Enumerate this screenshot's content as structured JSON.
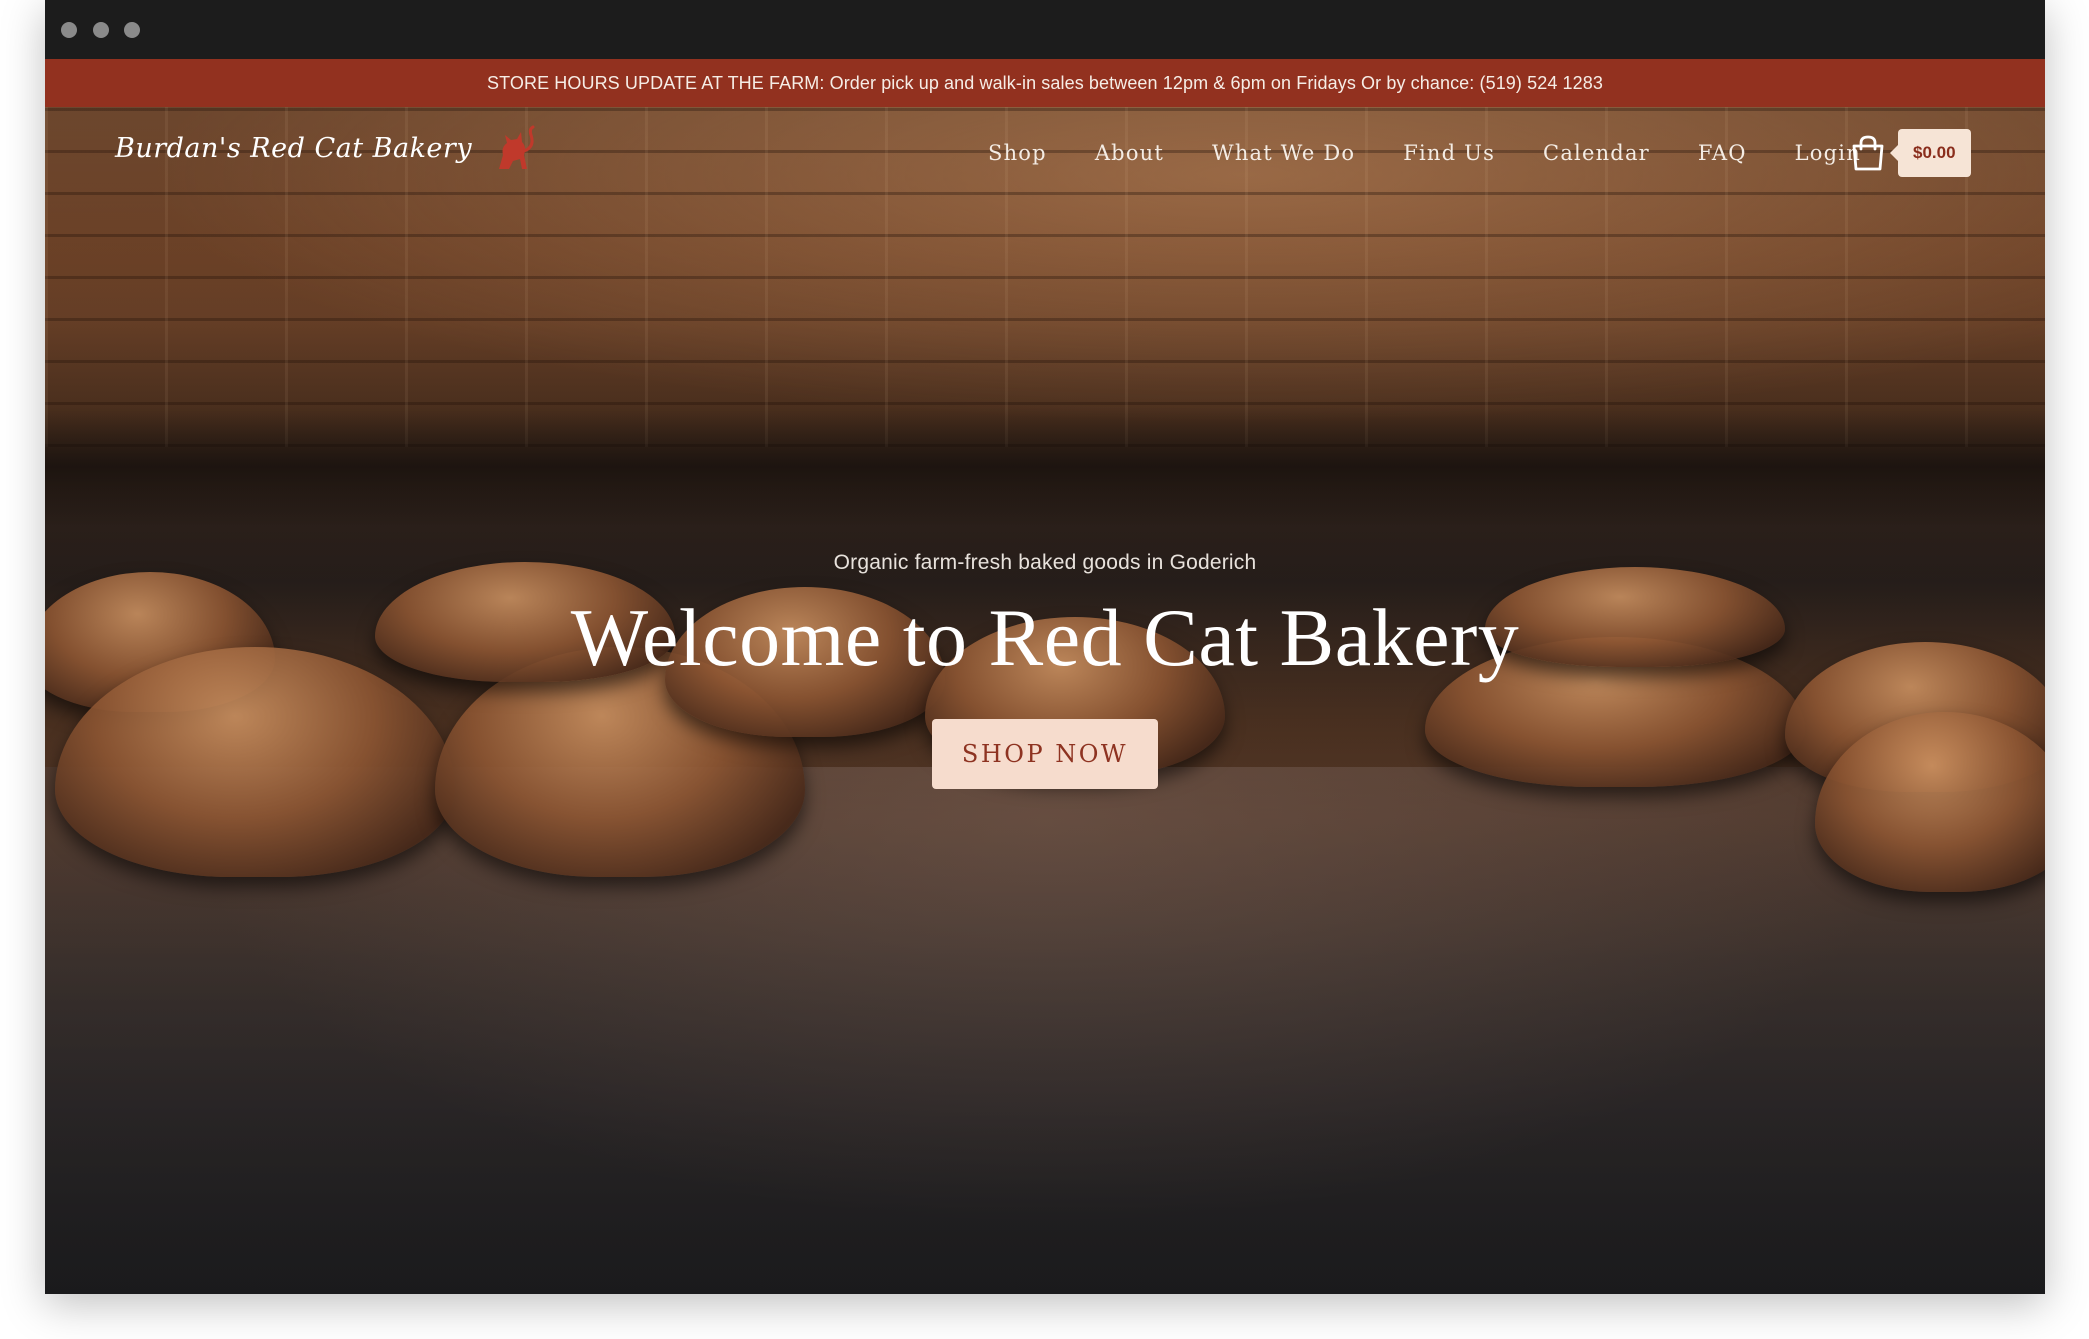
{
  "announcement": {
    "text": "STORE HOURS UPDATE AT THE FARM: Order pick up and walk-in sales between 12pm & 6pm on Fridays Or by chance: (519) 524 1283"
  },
  "header": {
    "logo_text": "Burdan's Red Cat Bakery",
    "logo_icon": "red-cat-icon",
    "nav": [
      {
        "label": "Shop"
      },
      {
        "label": "About"
      },
      {
        "label": "What We Do"
      },
      {
        "label": "Find Us"
      },
      {
        "label": "Calendar"
      },
      {
        "label": "FAQ"
      },
      {
        "label": "Login"
      }
    ],
    "cart": {
      "icon": "shopping-bag-icon",
      "total": "$0.00"
    }
  },
  "hero": {
    "subtitle": "Organic farm-fresh baked goods in Goderich",
    "title": "Welcome to Red Cat Bakery",
    "cta_label": "SHOP NOW"
  },
  "colors": {
    "announcement_bg": "#92311f",
    "cta_bg": "#f6dccd",
    "cta_text": "#8e3321",
    "logo_cat": "#c0392b"
  }
}
